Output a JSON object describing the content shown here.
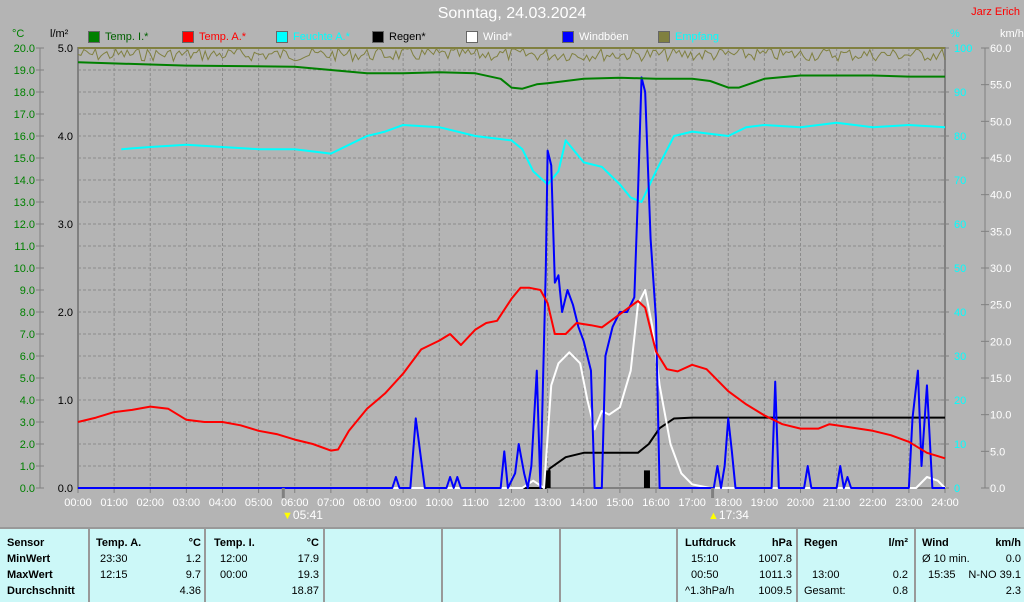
{
  "header": {
    "title": "Sonntag, 24.03.2024",
    "author": "Jarz Erich"
  },
  "axis_units": {
    "temp": "°C",
    "rain": "l/m²",
    "humidity": "%",
    "wind": "km/h"
  },
  "legend": [
    {
      "label": "Temp. I.*",
      "color": "#008000",
      "text_color": "#006000"
    },
    {
      "label": "Temp. A.*",
      "color": "#ff0000",
      "text_color": "#ff0000"
    },
    {
      "label": "Feuchte A.*",
      "color": "#00ffff",
      "text_color": "#00ffff"
    },
    {
      "label": "Regen*",
      "color": "#000000",
      "text_color": "#000000"
    },
    {
      "label": "Wind*",
      "color": "#ffffff",
      "text_color": "#ffffff"
    },
    {
      "label": "Windböen",
      "color": "#0000ff",
      "text_color": "#ffffff"
    },
    {
      "label": "Empfang",
      "color": "#808040",
      "text_color": "#00ffff"
    }
  ],
  "sun": {
    "sunrise": "05:41",
    "sunset": "17:34"
  },
  "chart_data": {
    "type": "line",
    "title": "Sonntag, 24.03.2024",
    "x_ticks": [
      "00:00",
      "01:00",
      "02:00",
      "03:00",
      "04:00",
      "05:00",
      "06:00",
      "07:00",
      "08:00",
      "09:00",
      "10:00",
      "11:00",
      "12:00",
      "13:00",
      "14:00",
      "15:00",
      "16:00",
      "17:00",
      "18:00",
      "19:00",
      "20:00",
      "21:00",
      "22:00",
      "23:00",
      "24:00"
    ],
    "xlim": [
      0,
      24
    ],
    "axes": {
      "temp": {
        "label": "°C",
        "ylim": [
          0,
          20
        ],
        "ticks": [
          "0.0",
          "1.0",
          "2.0",
          "3.0",
          "4.0",
          "5.0",
          "6.0",
          "7.0",
          "8.0",
          "9.0",
          "10.0",
          "11.0",
          "12.0",
          "13.0",
          "14.0",
          "15.0",
          "16.0",
          "17.0",
          "18.0",
          "19.0",
          "20.0"
        ]
      },
      "rain": {
        "label": "l/m²",
        "ylim": [
          0,
          5
        ],
        "ticks": [
          "0.0",
          "1.0",
          "2.0",
          "3.0",
          "4.0",
          "5.0"
        ]
      },
      "humidity": {
        "label": "%",
        "ylim": [
          0,
          100
        ],
        "ticks": [
          "0",
          "10",
          "20",
          "30",
          "40",
          "50",
          "60",
          "70",
          "80",
          "90",
          "100"
        ]
      },
      "wind": {
        "label": "km/h",
        "ylim": [
          0,
          60
        ],
        "ticks": [
          "0.0",
          "5.0",
          "10.0",
          "15.0",
          "20.0",
          "25.0",
          "30.0",
          "35.0",
          "40.0",
          "45.0",
          "50.0",
          "55.0",
          "60.0"
        ]
      }
    },
    "series": [
      {
        "name": "Temp. I.*",
        "axis": "temp",
        "color": "#008000",
        "points": [
          [
            0,
            19.35
          ],
          [
            3,
            19.2
          ],
          [
            6,
            19.15
          ],
          [
            7,
            19.0
          ],
          [
            8,
            18.85
          ],
          [
            9,
            18.85
          ],
          [
            10,
            18.9
          ],
          [
            11,
            18.85
          ],
          [
            11.7,
            18.6
          ],
          [
            12,
            18.2
          ],
          [
            12.3,
            18.15
          ],
          [
            12.7,
            18.35
          ],
          [
            13,
            18.4
          ],
          [
            14,
            18.6
          ],
          [
            15,
            18.65
          ],
          [
            16,
            18.6
          ],
          [
            17,
            18.6
          ],
          [
            17.5,
            18.5
          ],
          [
            18,
            18.2
          ],
          [
            18.3,
            18.2
          ],
          [
            19,
            18.6
          ],
          [
            20,
            18.75
          ],
          [
            21,
            18.75
          ],
          [
            22,
            18.75
          ],
          [
            23,
            18.7
          ],
          [
            24,
            18.7
          ]
        ]
      },
      {
        "name": "Temp. A.*",
        "axis": "temp",
        "color": "#ff0000",
        "points": [
          [
            0,
            3.0
          ],
          [
            0.5,
            3.2
          ],
          [
            1,
            3.45
          ],
          [
            1.5,
            3.55
          ],
          [
            2,
            3.7
          ],
          [
            2.5,
            3.6
          ],
          [
            3,
            3.1
          ],
          [
            3.5,
            3.0
          ],
          [
            4,
            3.0
          ],
          [
            4.5,
            2.85
          ],
          [
            5,
            2.6
          ],
          [
            5.5,
            2.45
          ],
          [
            6,
            2.2
          ],
          [
            6.5,
            2.0
          ],
          [
            7,
            1.7
          ],
          [
            7.2,
            1.75
          ],
          [
            7.5,
            2.6
          ],
          [
            8,
            3.6
          ],
          [
            8.5,
            4.3
          ],
          [
            9,
            5.2
          ],
          [
            9.5,
            6.3
          ],
          [
            10,
            6.7
          ],
          [
            10.3,
            7.0
          ],
          [
            10.6,
            6.5
          ],
          [
            11,
            7.2
          ],
          [
            11.3,
            7.5
          ],
          [
            11.6,
            7.6
          ],
          [
            12,
            8.6
          ],
          [
            12.25,
            9.1
          ],
          [
            12.5,
            9.1
          ],
          [
            12.8,
            9.0
          ],
          [
            13.0,
            8.4
          ],
          [
            13.2,
            7.0
          ],
          [
            13.5,
            7.0
          ],
          [
            13.8,
            7.5
          ],
          [
            14.2,
            7.4
          ],
          [
            14.5,
            7.3
          ],
          [
            15,
            7.9
          ],
          [
            15.5,
            8.5
          ],
          [
            15.7,
            8.2
          ],
          [
            16,
            6.2
          ],
          [
            16.3,
            5.4
          ],
          [
            16.6,
            5.3
          ],
          [
            17,
            5.6
          ],
          [
            17.4,
            5.4
          ],
          [
            18,
            4.4
          ],
          [
            18.5,
            3.8
          ],
          [
            19,
            3.3
          ],
          [
            19.5,
            2.9
          ],
          [
            20,
            2.7
          ],
          [
            20.5,
            2.7
          ],
          [
            20.8,
            2.9
          ],
          [
            21.2,
            2.8
          ],
          [
            22,
            2.6
          ],
          [
            22.5,
            2.4
          ],
          [
            23,
            2.1
          ],
          [
            23.5,
            1.6
          ],
          [
            24,
            1.35
          ]
        ]
      },
      {
        "name": "Feuchte A.*",
        "axis": "humidity",
        "color": "#00ffff",
        "points": [
          [
            1.2,
            77
          ],
          [
            2,
            77.5
          ],
          [
            3,
            78
          ],
          [
            4,
            77.5
          ],
          [
            5,
            77
          ],
          [
            6,
            77
          ],
          [
            7,
            76
          ],
          [
            7.5,
            78
          ],
          [
            8,
            80
          ],
          [
            8.5,
            81
          ],
          [
            9,
            82.5
          ],
          [
            10,
            82
          ],
          [
            11,
            80
          ],
          [
            12,
            79
          ],
          [
            12.3,
            77
          ],
          [
            12.6,
            72
          ],
          [
            13,
            69
          ],
          [
            13.3,
            72
          ],
          [
            13.5,
            79
          ],
          [
            14,
            74
          ],
          [
            14.5,
            73
          ],
          [
            15,
            69
          ],
          [
            15.3,
            66
          ],
          [
            15.6,
            65
          ],
          [
            16,
            72
          ],
          [
            16.5,
            80
          ],
          [
            17,
            81
          ],
          [
            18,
            80
          ],
          [
            18.5,
            82
          ],
          [
            19,
            82.5
          ],
          [
            20,
            82
          ],
          [
            21,
            83
          ],
          [
            22,
            82
          ],
          [
            23,
            82.5
          ],
          [
            24,
            82
          ]
        ]
      },
      {
        "name": "Regen*",
        "axis": "rain",
        "color": "#000000",
        "points": [
          [
            0,
            0
          ],
          [
            12.95,
            0
          ],
          [
            13.05,
            0.22
          ],
          [
            13.5,
            0.35
          ],
          [
            14,
            0.4
          ],
          [
            15.5,
            0.4
          ],
          [
            15.8,
            0.5
          ],
          [
            16.1,
            0.68
          ],
          [
            16.5,
            0.79
          ],
          [
            17,
            0.8
          ],
          [
            24,
            0.8
          ]
        ]
      },
      {
        "name": "Wind*",
        "axis": "wind",
        "color": "#ffffff",
        "points": [
          [
            0,
            0
          ],
          [
            12.3,
            0
          ],
          [
            12.6,
            1
          ],
          [
            12.9,
            0
          ],
          [
            13.1,
            14
          ],
          [
            13.3,
            17
          ],
          [
            13.6,
            18.5
          ],
          [
            13.9,
            17
          ],
          [
            14.1,
            12
          ],
          [
            14.3,
            8
          ],
          [
            14.5,
            10.5
          ],
          [
            14.7,
            10
          ],
          [
            15,
            11
          ],
          [
            15.3,
            16
          ],
          [
            15.5,
            25
          ],
          [
            15.7,
            27
          ],
          [
            15.9,
            22
          ],
          [
            16.1,
            14
          ],
          [
            16.4,
            6
          ],
          [
            16.7,
            2
          ],
          [
            17,
            0.5
          ],
          [
            17.5,
            0
          ],
          [
            23.2,
            0
          ],
          [
            23.5,
            1.5
          ],
          [
            23.8,
            1
          ],
          [
            24,
            0
          ]
        ]
      },
      {
        "name": "Windböen",
        "axis": "wind",
        "color": "#0000ff",
        "points": [
          [
            0,
            0
          ],
          [
            8.7,
            0
          ],
          [
            8.8,
            1.5
          ],
          [
            8.9,
            0
          ],
          [
            9.2,
            0
          ],
          [
            9.35,
            9.5
          ],
          [
            9.6,
            0
          ],
          [
            10.2,
            0
          ],
          [
            10.3,
            1.5
          ],
          [
            10.4,
            0
          ],
          [
            10.5,
            1.5
          ],
          [
            10.6,
            0
          ],
          [
            11.7,
            0
          ],
          [
            11.8,
            5
          ],
          [
            11.9,
            0
          ],
          [
            12.1,
            2
          ],
          [
            12.2,
            6
          ],
          [
            12.35,
            2
          ],
          [
            12.45,
            0
          ],
          [
            12.55,
            3
          ],
          [
            12.7,
            16
          ],
          [
            12.8,
            0
          ],
          [
            12.95,
            30
          ],
          [
            13.0,
            46
          ],
          [
            13.1,
            44
          ],
          [
            13.2,
            28
          ],
          [
            13.3,
            29
          ],
          [
            13.4,
            24
          ],
          [
            13.55,
            27
          ],
          [
            13.7,
            25
          ],
          [
            13.85,
            22
          ],
          [
            14.0,
            20
          ],
          [
            14.2,
            16
          ],
          [
            14.3,
            0
          ],
          [
            14.5,
            0
          ],
          [
            14.6,
            18
          ],
          [
            14.8,
            22
          ],
          [
            15.0,
            24
          ],
          [
            15.2,
            24
          ],
          [
            15.4,
            26
          ],
          [
            15.5,
            40
          ],
          [
            15.6,
            56
          ],
          [
            15.7,
            54
          ],
          [
            15.85,
            34
          ],
          [
            16.0,
            23
          ],
          [
            16.1,
            0
          ],
          [
            17.6,
            0
          ],
          [
            17.7,
            3
          ],
          [
            17.8,
            0
          ],
          [
            17.9,
            3
          ],
          [
            18.0,
            9.5
          ],
          [
            18.1,
            5
          ],
          [
            18.2,
            0
          ],
          [
            19.2,
            0
          ],
          [
            19.3,
            14.5
          ],
          [
            19.4,
            0
          ],
          [
            20.1,
            0
          ],
          [
            20.2,
            3
          ],
          [
            20.3,
            0
          ],
          [
            21.0,
            0
          ],
          [
            21.1,
            3
          ],
          [
            21.2,
            0
          ],
          [
            21.3,
            1.5
          ],
          [
            21.4,
            0
          ],
          [
            23.0,
            0
          ],
          [
            23.1,
            9.5
          ],
          [
            23.25,
            16
          ],
          [
            23.35,
            3
          ],
          [
            23.5,
            14
          ],
          [
            23.65,
            0
          ],
          [
            24,
            0
          ]
        ]
      }
    ],
    "rain_bars": [
      {
        "x": 13.0,
        "value": 0.2
      },
      {
        "x": 15.75,
        "value": 0.2
      }
    ],
    "reception": {
      "name": "Empfang",
      "axis": "humidity",
      "range": [
        97,
        100
      ]
    }
  },
  "table": {
    "sensor": {
      "header": "Sensor",
      "rows": [
        "MinWert",
        "MaxWert",
        "Durchschnitt"
      ]
    },
    "temp_a": {
      "header": "Temp. A.",
      "unit": "°C",
      "min_time": "23:30",
      "min": "1.2",
      "max_time": "12:15",
      "max": "9.7",
      "avg": "4.36"
    },
    "temp_i": {
      "header": "Temp. I.",
      "unit": "°C",
      "min_time": "12:00",
      "min": "17.9",
      "max_time": "00:00",
      "max": "19.3",
      "avg": "18.87"
    },
    "pressure": {
      "header": "Luftdruck",
      "unit": "hPa",
      "min_time": "15:10",
      "min": "1007.8",
      "max_time": "00:50",
      "max": "1011.3",
      "trend": "^1.3hPa/h",
      "current": "1009.5"
    },
    "rain": {
      "header": "Regen",
      "unit": "l/m²",
      "max_time": "13:00",
      "max": "0.2",
      "total_label": "Gesamt:",
      "total": "0.8"
    },
    "wind": {
      "header": "Wind",
      "unit": "km/h",
      "avg_label": "Ø 10 min.",
      "avg": "0.0",
      "max_time": "15:35",
      "max": "N-NO 39.1",
      "last": "2.3"
    }
  }
}
